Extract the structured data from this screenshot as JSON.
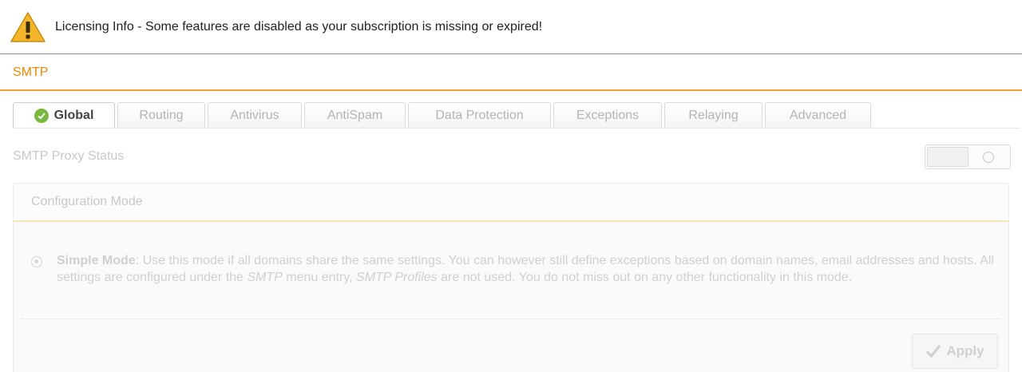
{
  "banner": {
    "icon": "warning-icon",
    "text": "Licensing Info - Some features are disabled as your subscription is missing or expired!"
  },
  "section": {
    "title": "SMTP"
  },
  "tabs": [
    {
      "label": "Global",
      "icon": "check-circle-icon",
      "active": true
    },
    {
      "label": "Routing"
    },
    {
      "label": "Antivirus"
    },
    {
      "label": "AntiSpam"
    },
    {
      "label": "Data Protection"
    },
    {
      "label": "Exceptions"
    },
    {
      "label": "Relaying"
    },
    {
      "label": "Advanced"
    }
  ],
  "proxy_status": {
    "label": "SMTP Proxy Status",
    "state": "off"
  },
  "config_mode": {
    "header": "Configuration Mode",
    "simple_mode": {
      "title": "Simple Mode",
      "text_1": ": Use this mode if all domains share the same settings. You can however still define exceptions based on domain names, email addresses and hosts. All settings are configured under the ",
      "em_1": "SMTP",
      "text_2": " menu entry, ",
      "em_2": "SMTP Profiles",
      "text_3": " are not used. You do not miss out on any other functionality in this mode."
    },
    "apply_label": "Apply"
  },
  "colors": {
    "accent": "#e88a00",
    "success": "#78b83c"
  }
}
